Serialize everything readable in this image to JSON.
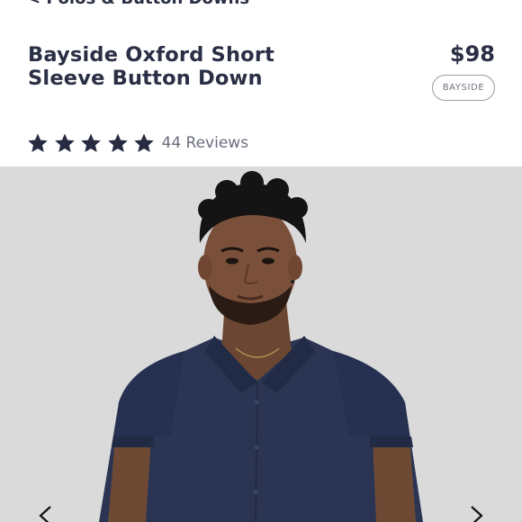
{
  "breadcrumb": {
    "label": "< Polos & Button Downs"
  },
  "product": {
    "title": "Bayside Oxford Short Sleeve Button Down",
    "price": "$98",
    "badge": "BAYSIDE"
  },
  "rating": {
    "stars": 5,
    "max_stars": 5,
    "reviews_label": "44 Reviews"
  },
  "gallery": {
    "prev_icon": "chevron-left-icon",
    "next_icon": "chevron-right-icon"
  },
  "colors": {
    "text": "#2a2f45",
    "star": "#262b42",
    "shirt": "#2b3553",
    "background": "#d9d9d9"
  }
}
